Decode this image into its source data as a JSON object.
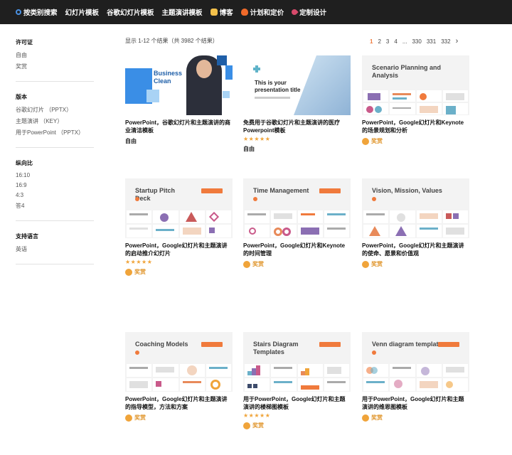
{
  "nav": {
    "items": [
      {
        "label": "按类别搜索",
        "icon": "search-icon"
      },
      {
        "label": "幻灯片模板",
        "icon": ""
      },
      {
        "label": "谷歌幻灯片模板",
        "icon": ""
      },
      {
        "label": "主题演讲模板",
        "icon": ""
      },
      {
        "label": "博客",
        "icon": "hand-icon"
      },
      {
        "label": "计划和定价",
        "icon": "fire-icon"
      },
      {
        "label": "定制设计",
        "icon": "rocket-icon"
      }
    ]
  },
  "sidebar": {
    "license": {
      "title": "许可证",
      "items": [
        "自由",
        "奖赏"
      ]
    },
    "version": {
      "title": "版本",
      "items": [
        "谷歌幻灯片 （PPTX）",
        "主题演讲 （KEY）",
        "用于PowerPoint （PPTX）"
      ]
    },
    "ratio": {
      "title": "纵向比",
      "items": [
        "16:10",
        "16:9",
        "4:3",
        "答4"
      ]
    },
    "language": {
      "title": "支持语言",
      "items": [
        "英语"
      ]
    }
  },
  "results": {
    "count_text": "显示 1-12 个结果（共 3982 个结果）"
  },
  "pagination": {
    "pages": [
      "1",
      "2",
      "3",
      "4",
      "...",
      "330",
      "331",
      "332"
    ],
    "next": "›",
    "current": "1"
  },
  "cards": [
    {
      "title": "PowerPoint，谷歌幻灯片和主题演讲的商业清洁模板",
      "tag": "自由",
      "stars": "",
      "thumb_title": "Business Clean"
    },
    {
      "title": "免费用于谷歌幻灯片和主题演讲的医疗Powerpoint模板",
      "tag": "自由",
      "stars": "★★★★★",
      "thumb_title": "This is your presentation title"
    },
    {
      "title": "PowerPoint，Google幻灯片和Keynote的场景规划和分析",
      "tag": "奖赏",
      "stars": "",
      "thumb_title": "Scenario Planning and Analysis"
    },
    {
      "title": "PowerPoint，Google幻灯片和主题演讲的启动推介幻灯片",
      "tag": "奖赏",
      "stars": "★★★★★",
      "thumb_title": "Startup Pitch Deck"
    },
    {
      "title": "PowerPoint，Google幻灯片和Keynote的时间管理",
      "tag": "奖赏",
      "stars": "",
      "thumb_title": "Time Management"
    },
    {
      "title": "PowerPoint，Google幻灯片和主题演讲的使命、愿景和价值观",
      "tag": "奖赏",
      "stars": "",
      "thumb_title": "Vision, Mission, Values"
    },
    {
      "title": "PowerPoint，Google幻灯片和主题演讲的指导模型，方法和方案",
      "tag": "奖赏",
      "stars": "",
      "thumb_title": "Coaching Models"
    },
    {
      "title": "用于PowerPoint，Google幻灯片和主题演讲的楼梯图模板",
      "tag": "奖赏",
      "stars": "★★★★★",
      "thumb_title": "Stairs Diagram Templates"
    },
    {
      "title": "用于PowerPoint，Google幻灯片和主题演讲的维恩图模板",
      "tag": "奖赏",
      "stars": "",
      "thumb_title": "Venn diagram templates"
    }
  ],
  "colors": {
    "accent": "#f07a3c",
    "premium": "#e0962d",
    "topbar": "#1f1f1f"
  }
}
